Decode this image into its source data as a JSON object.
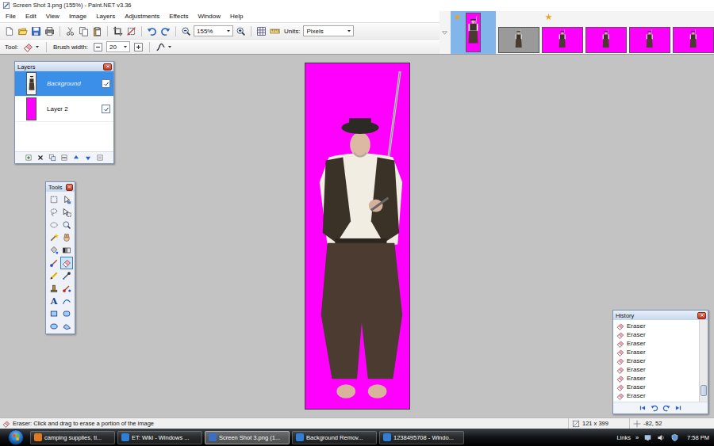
{
  "window": {
    "title": "Screen Shot 3.png (155%) - Paint.NET v3.36"
  },
  "menu": [
    "File",
    "Edit",
    "View",
    "Image",
    "Layers",
    "Adjustments",
    "Effects",
    "Window",
    "Help"
  ],
  "toolbar": {
    "zoom": "155%",
    "units_label": "Units:",
    "units": "Pixels",
    "tool_label": "Tool:",
    "brush_width_label": "Brush width:",
    "brush_width": "20"
  },
  "thumbnails": [
    {
      "selected": true,
      "modified": true,
      "kind": "tall",
      "color": "#ff00ff"
    },
    {
      "selected": false,
      "modified": false,
      "kind": "wide",
      "color": "#9a9a9a"
    },
    {
      "selected": false,
      "modified": true,
      "kind": "wide",
      "color": "#ff00ff"
    },
    {
      "selected": false,
      "modified": false,
      "kind": "wide",
      "color": "#ff00ff"
    },
    {
      "selected": false,
      "modified": false,
      "kind": "wide",
      "color": "#ff00ff"
    },
    {
      "selected": false,
      "modified": false,
      "kind": "wide",
      "color": "#ff00ff"
    }
  ],
  "layers": {
    "title": "Layers",
    "items": [
      {
        "name": "Background",
        "selected": true,
        "visible": true,
        "kind": "photo"
      },
      {
        "name": "Layer 2",
        "selected": false,
        "visible": true,
        "kind": "fill"
      }
    ]
  },
  "tools": {
    "title": "Tools",
    "items": [
      {
        "selected": false
      },
      {
        "selected": false
      },
      {
        "selected": false
      },
      {
        "selected": false
      },
      {
        "selected": false
      },
      {
        "selected": false
      },
      {
        "selected": false
      },
      {
        "selected": false
      },
      {
        "selected": false
      },
      {
        "selected": false
      },
      {
        "selected": false
      },
      {
        "selected": true
      },
      {
        "selected": false
      },
      {
        "selected": false
      },
      {
        "selected": false
      },
      {
        "selected": false
      },
      {
        "selected": false,
        "glyph": "A"
      },
      {
        "selected": false
      },
      {
        "selected": false
      },
      {
        "selected": false
      },
      {
        "selected": false
      },
      {
        "selected": false
      }
    ]
  },
  "history": {
    "title": "History",
    "items": [
      "Eraser",
      "Eraser",
      "Eraser",
      "Eraser",
      "Eraser",
      "Eraser",
      "Eraser",
      "Eraser",
      "Eraser"
    ],
    "scroll_level": 0.92
  },
  "status_bar": {
    "hint": "Eraser: Click and drag to erase a portion of the image",
    "image_size": "121 x 399",
    "cursor": "-82, 52"
  },
  "taskbar": {
    "items": [
      {
        "label": "camping supplies, ti...",
        "selected": false
      },
      {
        "label": "ET: Wiki - Windows ...",
        "selected": false
      },
      {
        "label": "Screen Shot 3.png (1...",
        "selected": true
      },
      {
        "label": "Background Remov...",
        "selected": false
      },
      {
        "label": "1238495708 - Windo...",
        "selected": false
      }
    ],
    "links": "Links",
    "chevron": "»",
    "clock": "7:58 PM"
  }
}
